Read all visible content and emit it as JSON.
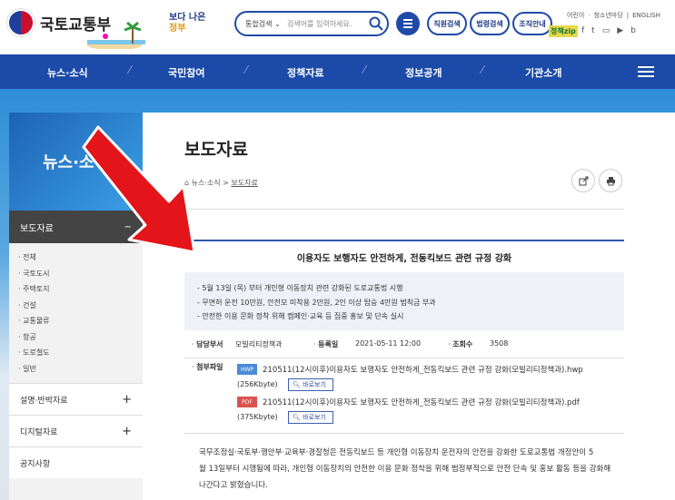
{
  "header": {
    "logo_text": "국토교통부",
    "slogan_line1": "보다 나은",
    "slogan_line2": "정부",
    "search_select": "통합검색",
    "search_placeholder": "검색어를 입력하세요.",
    "pill_staff": "직원검색",
    "pill_law": "법령검색",
    "pill_org": "조직안내",
    "top_links": [
      "어린이",
      "청소년마당",
      "ENGLISH"
    ],
    "zip_label": "정책zip",
    "sns": [
      "f",
      "t",
      "▭",
      "▶",
      "b"
    ]
  },
  "nav": {
    "items": [
      "뉴스·소식",
      "국민참여",
      "정책자료",
      "정보공개",
      "기관소개"
    ]
  },
  "sidebar": {
    "heading": "뉴스·소식",
    "selected": "보도자료",
    "selected_toggle": "−",
    "sub_items": [
      "전체",
      "국토도시",
      "주택토지",
      "건설",
      "교통물류",
      "항공",
      "도로철도",
      "일반"
    ],
    "rows": [
      {
        "label": "설명·반박자료",
        "toggle": "+"
      },
      {
        "label": "디지털자료",
        "toggle": "+"
      },
      {
        "label": "공지사항",
        "toggle": ""
      }
    ]
  },
  "main": {
    "title": "보도자료",
    "breadcrumb_home": "⌂",
    "breadcrumb_1": "뉴스·소식",
    "breadcrumb_sep": ">",
    "breadcrumb_2": "보도자료",
    "article_title": "이용자도 보행자도 안전하게, 전동킥보드 관련 규정 강화",
    "summary": [
      "- 5월 13일 (목) 부터 개인형 이동장치 관련 강화된 도로교통법 시행",
      "- 무면허 운전 10만원, 안전모 미착용 2만원, 2인 이상 탑승 4만원 범칙금 부과",
      "- 안전한 이용 문화 정착 위해 캠페인·교육 등 집중 홍보 및 단속 실시"
    ],
    "meta": {
      "dept_label": "담당부서",
      "dept_value": "모빌리티정책과",
      "date_label": "등록일",
      "date_value": "2021-05-11 12:00",
      "views_label": "조회수",
      "views_value": "3508"
    },
    "attach_label": "첨부파일",
    "files": [
      {
        "type": "HWP",
        "color": "#4a8bd8",
        "name": "210511(12시이후)이용자도 보행자도 안전하게_전동킥보드 관련 규정 강화(모빌리티정책과).hwp",
        "size": "(256Kbyte)",
        "button": "바로보기"
      },
      {
        "type": "PDF",
        "color": "#d9534f",
        "name": "210511(12시이후)이용자도 보행자도 안전하게_전동킥보드 관련 규정 강화(모빌리티정책과).pdf",
        "size": "(375Kbyte)",
        "button": "바로보기"
      }
    ],
    "body_lines": [
      "국무조정실·국토부·행안부·교육부·경찰청은 전동킥보드 등 개인형 이동장치 운전자의 안전을 강화한 도로교통법 개정안이 5",
      "월 13일부터 시행됨에 따라, 개인형 이동장치의 안전한 이용 문화 정착을 위해 범정부적으로 안전 단속 및 홍보 활동 등을 강화해",
      "나간다고 밝혔습니다."
    ]
  },
  "colors": {
    "nav_blue": "#1b4aa8",
    "accent_blue": "#2e56ad",
    "arrow_red": "#e3151b"
  }
}
